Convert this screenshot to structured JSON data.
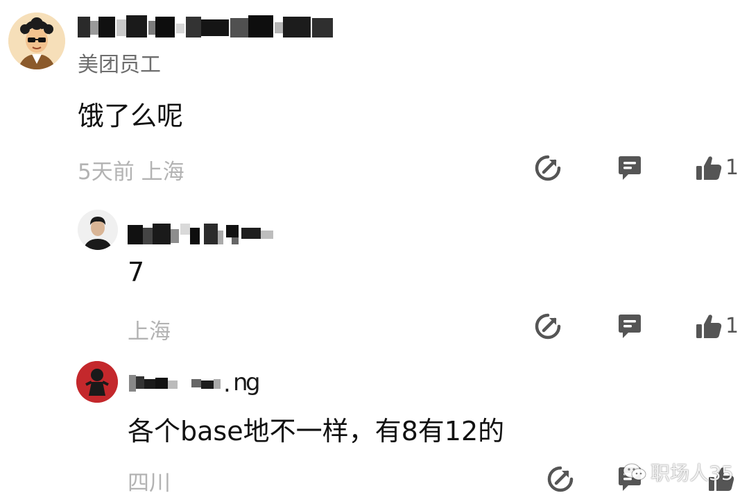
{
  "comments": [
    {
      "subtitle": "美团员工",
      "content": "饿了么呢",
      "meta": "5天前 上海",
      "like_count": "1"
    },
    {
      "content": "7",
      "meta": "上海",
      "like_count": "1"
    },
    {
      "content": "各个base地不一样，有8有12的",
      "meta": "四川"
    }
  ],
  "watermark": "职场人35",
  "icons": {
    "share": "share-icon",
    "reply": "reply-icon",
    "like": "thumbs-up-icon"
  }
}
